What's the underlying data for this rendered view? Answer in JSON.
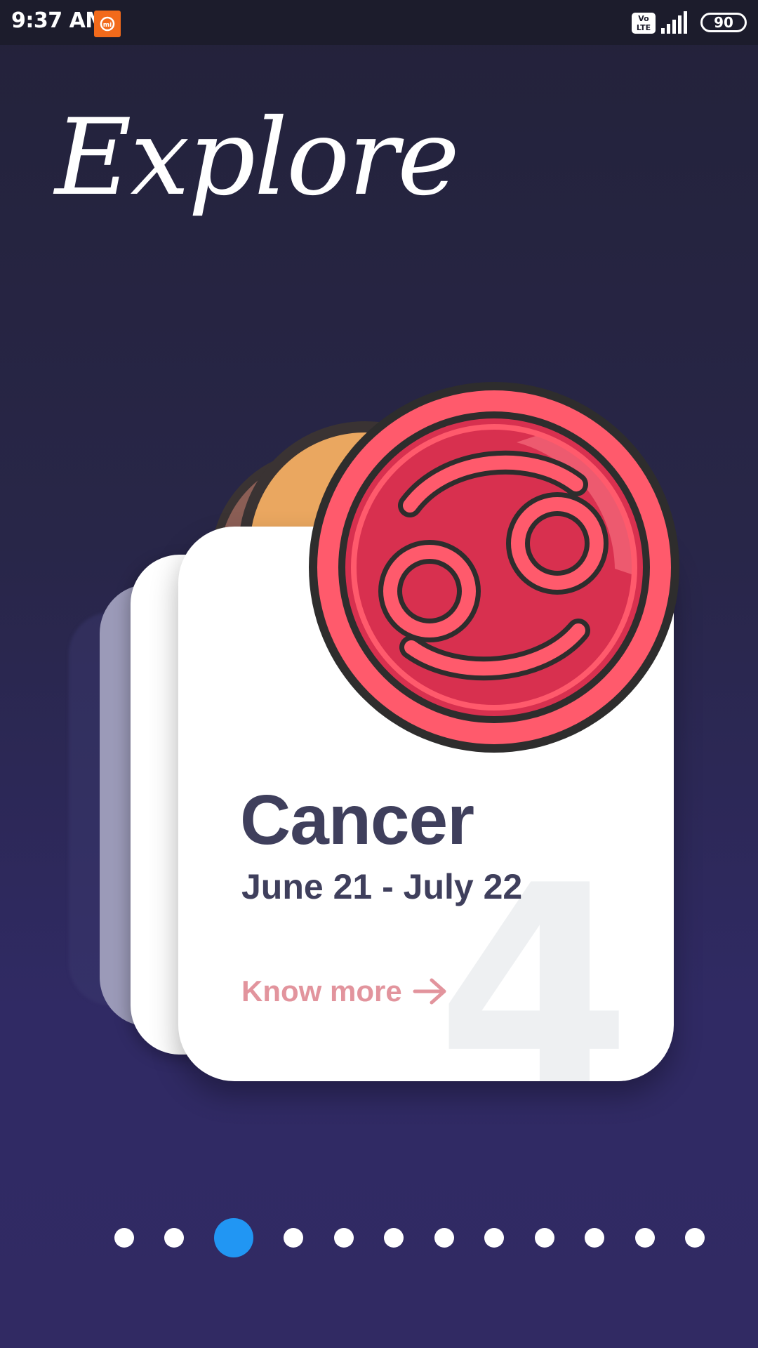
{
  "status_bar": {
    "time": "9:37 AM",
    "network_label": "Vo LTE",
    "battery": "90"
  },
  "page": {
    "title": "Explore"
  },
  "card": {
    "sign_name": "Cancer",
    "dates": "June 21 - July 22",
    "number": "4",
    "cta_label": "Know more",
    "colors": {
      "coin_red": "#e23a55",
      "cta": "#e2949d",
      "text": "#3f3f5c"
    }
  },
  "pagination": {
    "count": 12,
    "active_index": 2,
    "active_color": "#2196f3"
  }
}
